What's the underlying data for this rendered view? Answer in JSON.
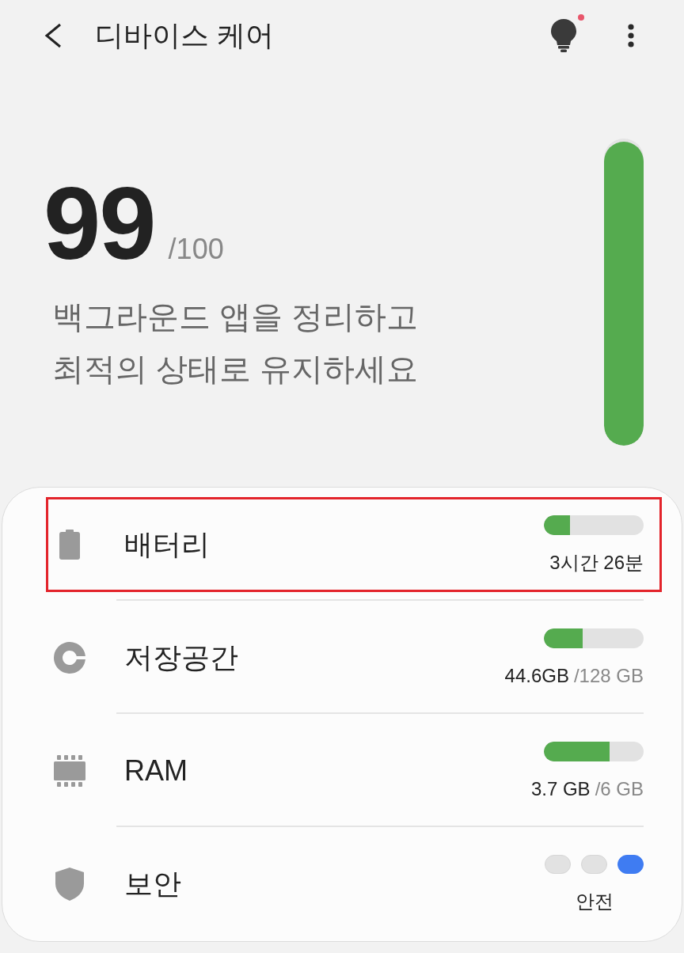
{
  "header": {
    "title": "디바이스 케어",
    "tips_badge": true
  },
  "score": {
    "value": "99",
    "max": "/100",
    "message": "백그라운드 앱을 정리하고\n최적의 상태로 유지하세요",
    "level": 0.99
  },
  "rows": [
    {
      "kind": "battery",
      "label": "배터리",
      "highlighted": true,
      "level": 0.26,
      "reading": "3시간 26분"
    },
    {
      "kind": "storage",
      "label": "저장공간",
      "highlighted": false,
      "level": 0.39,
      "reading": "44.6GB",
      "total": "/128 GB"
    },
    {
      "kind": "memory",
      "label": "RAM",
      "highlighted": false,
      "level": 0.66,
      "reading": "3.7 GB",
      "total": "/6 GB"
    },
    {
      "kind": "security",
      "label": "보안",
      "highlighted": false,
      "indicators": [
        {
          "selected": false
        },
        {
          "selected": false
        },
        {
          "selected": true
        }
      ],
      "reading": "안전"
    }
  ]
}
